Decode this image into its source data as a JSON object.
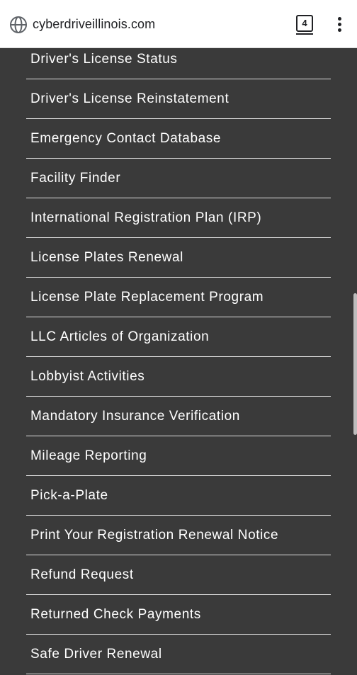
{
  "browser": {
    "url": "cyberdriveillinois.com",
    "tab_count": "4",
    "site_icon": "globe-icon",
    "menu_icon": "more-vert-icon"
  },
  "menu": {
    "items": [
      {
        "label": "Driver's License Status"
      },
      {
        "label": "Driver's License Reinstatement"
      },
      {
        "label": "Emergency Contact Database"
      },
      {
        "label": "Facility Finder"
      },
      {
        "label": "International Registration Plan (IRP)"
      },
      {
        "label": "License Plates Renewal"
      },
      {
        "label": "License Plate Replacement Program"
      },
      {
        "label": "LLC Articles of Organization"
      },
      {
        "label": "Lobbyist Activities"
      },
      {
        "label": "Mandatory Insurance Verification"
      },
      {
        "label": "Mileage Reporting"
      },
      {
        "label": "Pick-a-Plate"
      },
      {
        "label": "Print Your Registration Renewal Notice"
      },
      {
        "label": "Refund Request"
      },
      {
        "label": "Returned Check Payments"
      },
      {
        "label": "Safe Driver Renewal"
      }
    ]
  },
  "colors": {
    "menu_background": "#3a3a3a",
    "menu_text": "#ffffff",
    "divider": "#e0e0e0",
    "toolbar_background": "#ffffff"
  }
}
